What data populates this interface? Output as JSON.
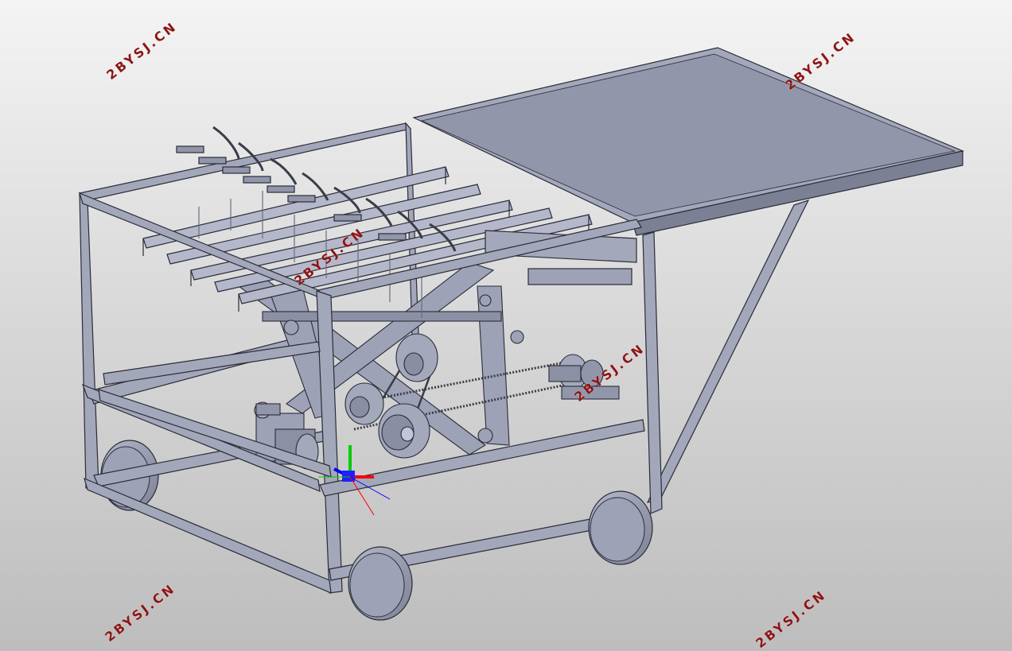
{
  "model_view": {
    "subject": "mobile cart with scissor-lift frame, chain drive and wheels",
    "background_colors": [
      "#f4f4f4",
      "#bdbdbd"
    ],
    "part_color": "#9ea2b6",
    "edge_color": "#2a2c38",
    "triad_colors": {
      "x": "#ff0000",
      "y": "#00cc00",
      "z": "#0000ff"
    }
  },
  "watermarks": [
    {
      "text": "2BYSJ.CN"
    },
    {
      "text": "2BYSJ.CN"
    },
    {
      "text": "2BYSJ.CN"
    },
    {
      "text": "2BYSJ.CN"
    },
    {
      "text": "2BYSJ.CN"
    },
    {
      "text": "2BYSJ.CN"
    }
  ]
}
